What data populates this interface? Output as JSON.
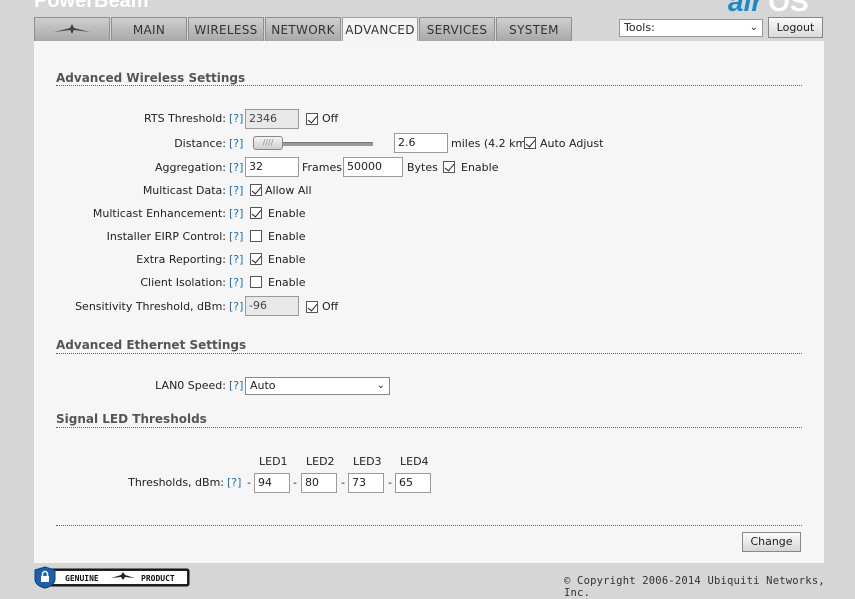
{
  "header": {
    "brand_left": "PowerBeam",
    "brand_right_a": "air",
    "brand_right_b": "OS",
    "tabs": [
      {
        "label": "MAIN"
      },
      {
        "label": "WIRELESS"
      },
      {
        "label": "NETWORK"
      },
      {
        "label": "ADVANCED",
        "active": true
      },
      {
        "label": "SERVICES"
      },
      {
        "label": "SYSTEM"
      }
    ],
    "tools_value": "Tools:",
    "logout_label": "Logout"
  },
  "wireless": {
    "title": "Advanced Wireless Settings",
    "help": "[?]",
    "rts": {
      "label": "RTS Threshold:",
      "value": "2346",
      "off_label": "Off",
      "off_checked": true
    },
    "distance": {
      "label": "Distance:",
      "value": "2.6",
      "unit_text": "miles (4.2 km)",
      "auto_label": "Auto Adjust",
      "auto_checked": true
    },
    "aggregation": {
      "label": "Aggregation:",
      "frames": "32",
      "frames_label": "Frames",
      "bytes": "50000",
      "bytes_label": "Bytes",
      "enable_label": "Enable",
      "enable_checked": true
    },
    "multicast": {
      "label": "Multicast Data:",
      "option_label": "Allow All",
      "checked": true
    },
    "multicast_enh": {
      "label": "Multicast Enhancement:",
      "option_label": "Enable",
      "checked": true
    },
    "eirp": {
      "label": "Installer EIRP Control:",
      "option_label": "Enable",
      "checked": false
    },
    "extra": {
      "label": "Extra Reporting:",
      "option_label": "Enable",
      "checked": true
    },
    "isolation": {
      "label": "Client Isolation:",
      "option_label": "Enable",
      "checked": false
    },
    "sensitivity": {
      "label": "Sensitivity Threshold, dBm:",
      "value": "-96",
      "off_label": "Off",
      "off_checked": true
    }
  },
  "ethernet": {
    "title": "Advanced Ethernet Settings",
    "lan_label": "LAN0 Speed:",
    "lan_value": "Auto"
  },
  "led": {
    "title": "Signal LED Thresholds",
    "label": "Thresholds, dBm:",
    "headers": [
      "LED1",
      "LED2",
      "LED3",
      "LED4"
    ],
    "values": [
      "94",
      "80",
      "73",
      "65"
    ],
    "dash": "-"
  },
  "change_label": "Change",
  "footer": {
    "badge_text_a": "GENUINE",
    "badge_text_b": "PRODUCT",
    "copyright": "© Copyright 2006-2014 Ubiquiti Networks, Inc."
  },
  "colors": {
    "link": "#1a6fb5",
    "brand_accent": "#1b88c8"
  }
}
